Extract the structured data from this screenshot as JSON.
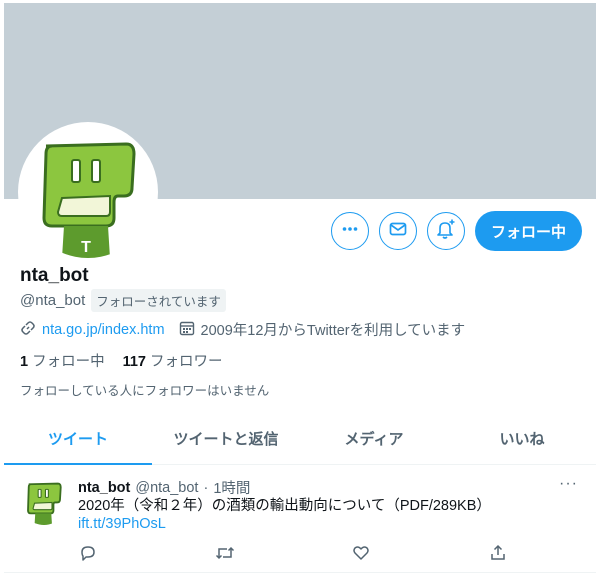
{
  "profile": {
    "name": "nta_bot",
    "handle": "@nta_bot",
    "follows_you_badge": "フォローされています",
    "link": "nta.go.jp/index.htm",
    "joined": "2009年12月からTwitterを利用しています",
    "following_count": "1",
    "following_label": "フォロー中",
    "followers_count": "117",
    "followers_label": "フォロワー",
    "followed_by_note": "フォローしている人にフォロワーはいません"
  },
  "actions": {
    "more_icon": "ellipsis-icon",
    "message_icon": "envelope-icon",
    "notify_icon": "bell-plus-icon",
    "follow_label": "フォロー中"
  },
  "tabs": [
    {
      "label": "ツイート",
      "active": true
    },
    {
      "label": "ツイートと返信",
      "active": false
    },
    {
      "label": "メディア",
      "active": false
    },
    {
      "label": "いいね",
      "active": false
    }
  ],
  "tweet": {
    "name": "nta_bot",
    "handle": "@nta_bot",
    "separator": "·",
    "time": "1時間",
    "text": "2020年（令和２年）の酒類の輸出動向について（PDF/289KB）",
    "link": "ift.tt/39PhOsL",
    "more": "···"
  },
  "colors": {
    "accent": "#1d9bf0",
    "banner": "#c4cfd6",
    "logo_green": "#8cc63f",
    "logo_dark": "#3a6e1f"
  }
}
